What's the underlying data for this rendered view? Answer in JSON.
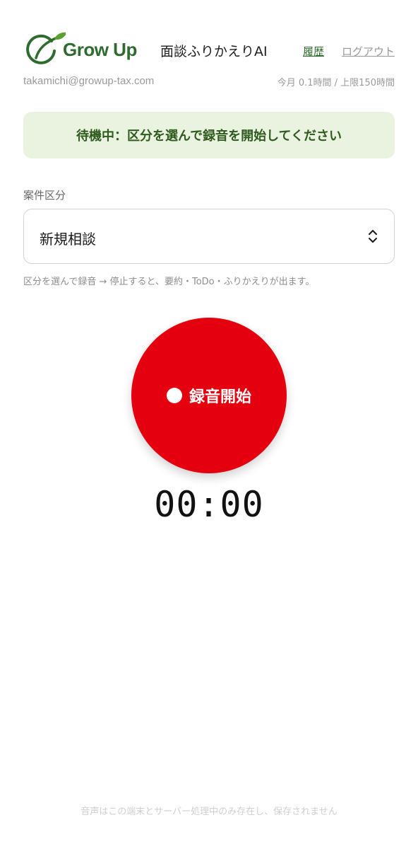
{
  "header": {
    "logo_text": "Grow Up",
    "app_title": "面談ふりかえりAI",
    "nav_history": "履歴",
    "nav_logout": "ログアウト"
  },
  "account": {
    "email": "takamichi@growup-tax.com",
    "usage": "今月 0.1時間 / 上限150時間"
  },
  "status": {
    "text": "待機中：区分を選んで録音を開始してください"
  },
  "category": {
    "label": "案件区分",
    "selected": "新規相談"
  },
  "hint": "区分を選んで録音 → 停止すると、要約・ToDo・ふりかえりが出ます。",
  "record": {
    "label": "録音開始"
  },
  "timer": "00:00",
  "footer": "音声はこの端末とサーバー処理中のみ存在し、保存されません",
  "colors": {
    "brand_green": "#2f6b2f",
    "banner_bg": "#eaf3e0",
    "record_red": "#e5000f"
  }
}
